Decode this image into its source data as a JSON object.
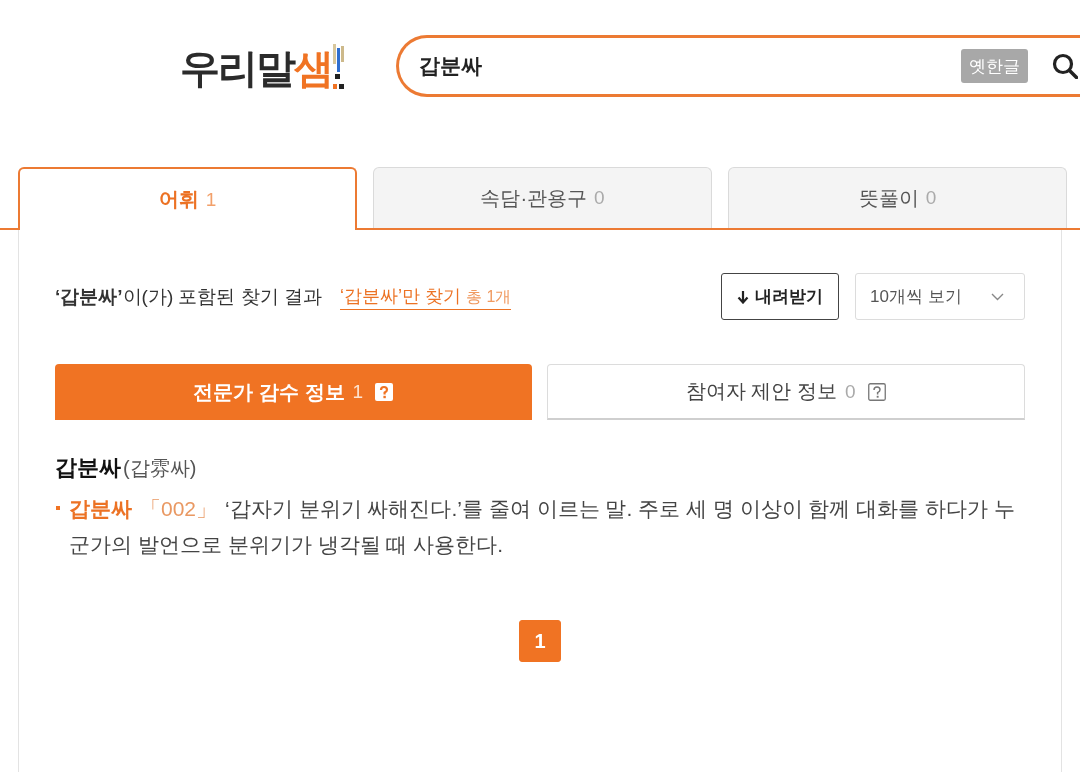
{
  "header": {
    "logo": {
      "text": "우리말",
      "accent": "샘"
    },
    "search": {
      "value": "갑분싸",
      "old_hangul_button": "옛한글"
    }
  },
  "tabs": [
    {
      "label": "어휘",
      "count": "1",
      "selected": true
    },
    {
      "label": "속담·관용구",
      "count": "0",
      "selected": false
    },
    {
      "label": "뜻풀이",
      "count": "0",
      "selected": false
    }
  ],
  "results": {
    "summary": "**‘갑분싸’**이(가) 포함된 찾기 결과",
    "exact_link": {
      "label": "‘갑분싸’만 찾기",
      "count": "총 1개"
    },
    "download_button": "내려받기",
    "page_size": "10개씩 보기"
  },
  "subtabs": [
    {
      "label": "전문가 감수 정보",
      "count": "1",
      "selected": true
    },
    {
      "label": "참여자 제안 정보",
      "count": "0",
      "selected": false
    }
  ],
  "entries": [
    {
      "headword": "갑분싸",
      "origin": "(갑雰싸)",
      "senses": [
        {
          "word": "갑분싸",
          "number": "「002」",
          "definition": "‘갑자기 분위기 싸해진다.’를 줄여 이르는 말. 주로 세 명 이상이 함께 대화를 하다가 누군가의 발언으로 분위기가 냉각될 때 사용한다."
        }
      ]
    }
  ],
  "pagination": [
    {
      "label": "1",
      "selected": true
    }
  ]
}
